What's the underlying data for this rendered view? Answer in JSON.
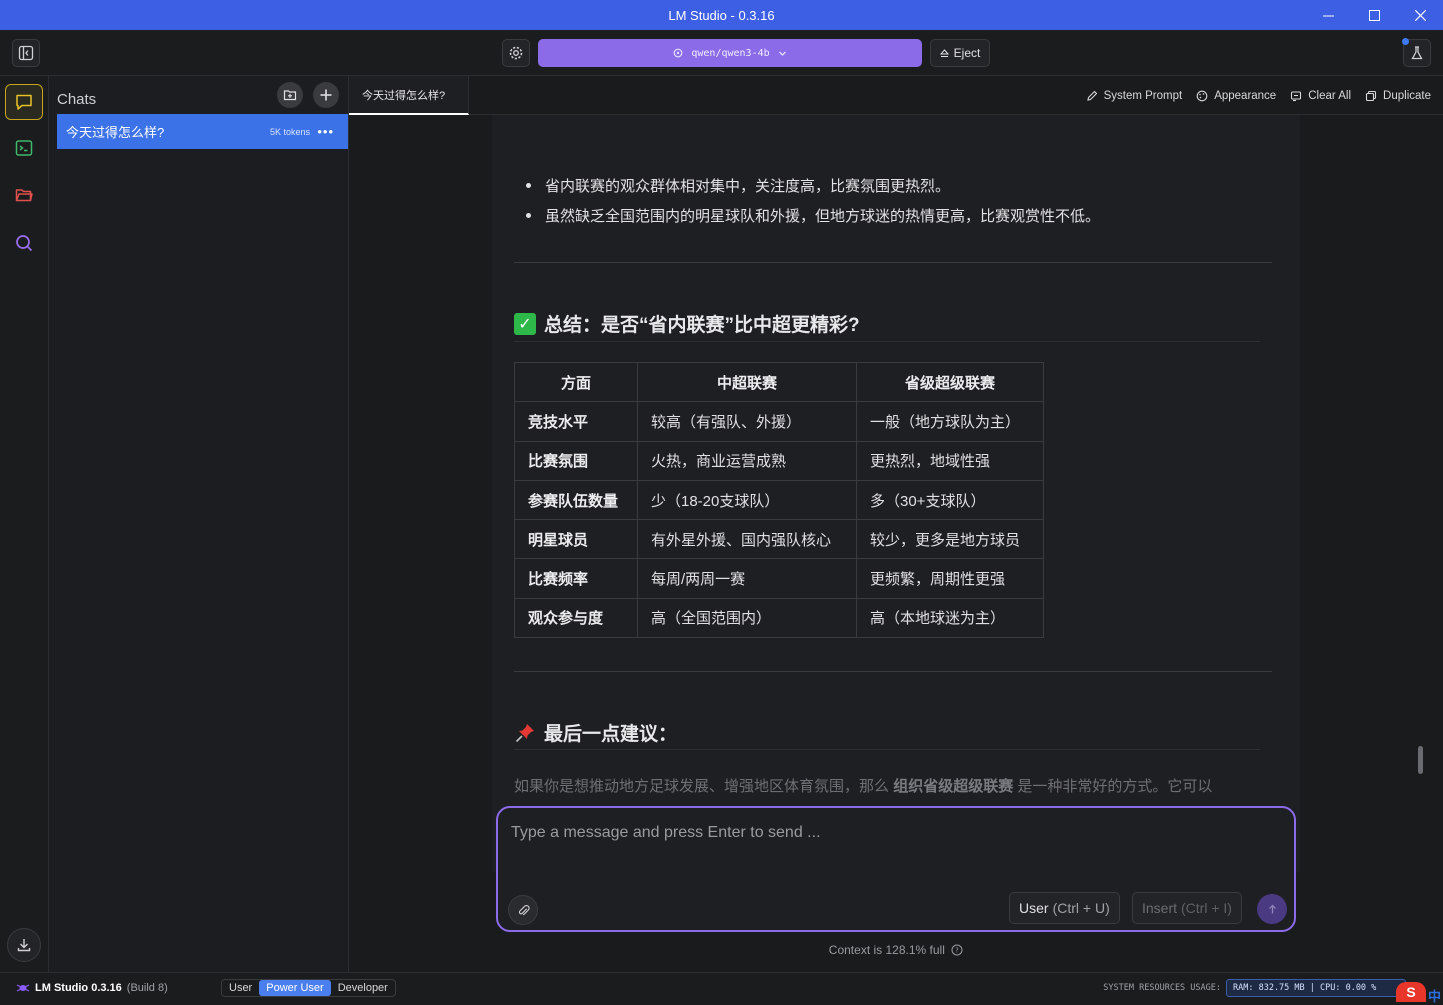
{
  "window": {
    "title": "LM Studio - 0.3.16"
  },
  "topbar": {
    "model": "qwen/qwen3-4b",
    "eject_label": "Eject"
  },
  "sidebar": {
    "title": "Chats",
    "chats": [
      {
        "title": "今天过得怎么样?",
        "tokens": "5K tokens"
      }
    ]
  },
  "tab": {
    "title": "今天过得怎么样?"
  },
  "toolbar": {
    "system_prompt": "System Prompt",
    "appearance": "Appearance",
    "clear_all": "Clear All",
    "duplicate": "Duplicate"
  },
  "message": {
    "bullets": [
      "省内联赛的观众群体相对集中，关注度高，比赛氛围更热烈。",
      "虽然缺乏全国范围内的明星球队和外援，但地方球迷的热情更高，比赛观赏性不低。"
    ],
    "summary_heading": "总结：是否“省内联赛”比中超更精彩?",
    "table": {
      "headers": [
        "方面",
        "中超联赛",
        "省级超级联赛"
      ],
      "rows": [
        [
          "竞技水平",
          "较高（有强队、外援）",
          "一般（地方球队为主）"
        ],
        [
          "比赛氛围",
          "火热，商业运营成熟",
          "更热烈，地域性强"
        ],
        [
          "参赛队伍数量",
          "少（18-20支球队）",
          "多（30+支球队）"
        ],
        [
          "明星球员",
          "有外星外援、国内强队核心",
          "较少，更多是地方球员"
        ],
        [
          "比赛频率",
          "每周/两周一赛",
          "更频繁，周期性更强"
        ],
        [
          "观众参与度",
          "高（全国范围内）",
          "高（本地球迷为主）"
        ]
      ]
    },
    "advice_heading": "最后一点建议：",
    "advice_pre": "如果你是想推动地方足球发展、增强地区体育氛围，那么",
    "advice_bold": "组织省级超级联赛",
    "advice_post": "是一种非常好的方式。它可以"
  },
  "composer": {
    "placeholder": "Type a message and press Enter to send ...",
    "user_label": "User",
    "user_shortcut": "(Ctrl + U)",
    "insert_label": "Insert",
    "insert_shortcut": "(Ctrl + I)",
    "context": "Context is 128.1% full"
  },
  "status": {
    "app": "LM Studio 0.3.16",
    "build": "(Build 8)",
    "modes": [
      "User",
      "Power User",
      "Developer"
    ],
    "active_mode": "Power User",
    "resources_label": "SYSTEM RESOURCES USAGE:",
    "resources_value": "RAM: 832.75 MB | CPU: 0.00 %",
    "ime_letter": "S",
    "ime_char": "中"
  },
  "colors": {
    "title_bar": "#3c5fe3",
    "model_pill": "#8b6be8",
    "selected_chat": "#3c72e8",
    "chats_rail_accent": "#c9a51c"
  }
}
